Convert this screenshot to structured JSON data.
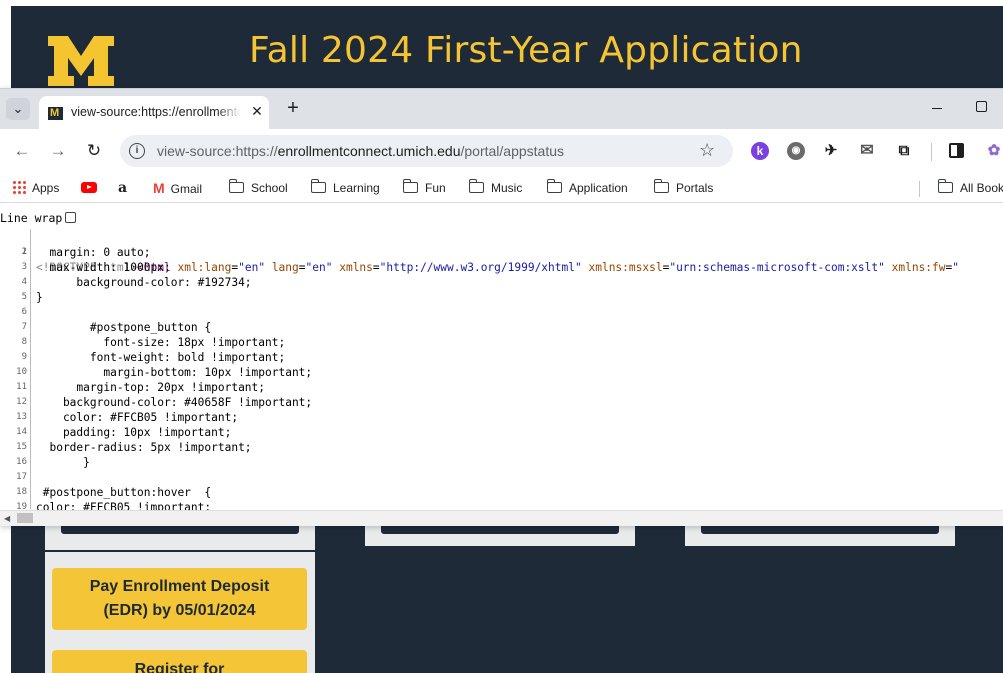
{
  "background_page": {
    "logo_letter": "M",
    "title": "Fall 2024 First-Year Application",
    "deposit_button": [
      "Pay Enrollment Deposit",
      "(EDR) by 05/01/2024"
    ],
    "register_button": "Register for",
    "colors": {
      "navy": "#1e2a38",
      "maize": "#f5c531",
      "panel": "#e9eaec",
      "button": "#f4c536"
    }
  },
  "browser": {
    "tab": {
      "title": "view-source:https://enrollmentconnect.umich.edu/portal/appstatus",
      "favicon": "umich-m-favicon",
      "close_glyph": "✕"
    },
    "tab_search_glyph": "⌄",
    "new_tab_glyph": "+",
    "nav": {
      "back": "←",
      "forward": "→",
      "reload": "↻"
    },
    "url": {
      "scheme": "view-source:https://",
      "host": "enrollmentconnect.umich.edu",
      "path": "/portal/appstatus"
    },
    "info_glyph": "i",
    "star_glyph": "☆",
    "extensions": [
      {
        "name": "k-extension-icon",
        "glyph": "k"
      },
      {
        "name": "tomato-extension-icon",
        "glyph": "◉"
      },
      {
        "name": "bird-extension-icon",
        "glyph": "✈"
      },
      {
        "name": "mail-extension-icon",
        "glyph": "✉"
      },
      {
        "name": "puzzle-extensions-icon",
        "glyph": "⧉"
      },
      {
        "name": "owl-extension-icon",
        "glyph": "✿"
      }
    ],
    "bookmarks": {
      "items": [
        {
          "label": "Apps",
          "icon": "apps-grid-icon"
        },
        {
          "label": "",
          "icon": "youtube-icon"
        },
        {
          "label": "a",
          "icon": "amazon-icon"
        },
        {
          "label": "Gmail",
          "icon": "gmail-icon"
        },
        {
          "label": "School",
          "icon": "folder-icon"
        },
        {
          "label": "Learning",
          "icon": "folder-icon"
        },
        {
          "label": "Fun",
          "icon": "folder-icon"
        },
        {
          "label": "Music",
          "icon": "folder-icon"
        },
        {
          "label": "Application",
          "icon": "folder-icon"
        },
        {
          "label": "Portals",
          "icon": "folder-icon"
        }
      ],
      "all_bookmarks": "All Bookmarks"
    },
    "gmail_glyph": "M"
  },
  "source_view": {
    "line_wrap_label": "Line wrap",
    "line_wrap_checked": false,
    "lines": [
      {
        "n": "1",
        "doctype": "<!DOCTYPE html>",
        "tag_open": "<html ",
        "attrs": [
          {
            "name": "xml:lang",
            "value": "\"en\""
          },
          {
            "name": "lang",
            "value": "\"en\""
          },
          {
            "name": "xmlns",
            "value": "\"http://www.w3.org/1999/xhtml\""
          },
          {
            "name": "xmlns:msxsl",
            "value": "\"urn:schemas-microsoft-com:xslt\""
          },
          {
            "name": "xmlns:fw",
            "value": "\""
          }
        ]
      },
      {
        "n": "2",
        "text": "  margin: 0 auto;"
      },
      {
        "n": "3",
        "text": "  max-width: 1000px;"
      },
      {
        "n": "4",
        "text": "      background-color: #192734;"
      },
      {
        "n": "5",
        "text": "}"
      },
      {
        "n": "6",
        "text": ""
      },
      {
        "n": "7",
        "text": "        #postpone_button {"
      },
      {
        "n": "8",
        "text": "          font-size: 18px !important;"
      },
      {
        "n": "9",
        "text": "        font-weight: bold !important;"
      },
      {
        "n": "10",
        "text": "          margin-bottom: 10px !important;"
      },
      {
        "n": "11",
        "text": "      margin-top: 20px !important;"
      },
      {
        "n": "12",
        "text": "    background-color: #40658F !important;"
      },
      {
        "n": "13",
        "text": "    color: #FFCB05 !important;"
      },
      {
        "n": "14",
        "text": "    padding: 10px !important;"
      },
      {
        "n": "15",
        "text": "  border-radius: 5px !important;"
      },
      {
        "n": "16",
        "text": "       }"
      },
      {
        "n": "17",
        "text": ""
      },
      {
        "n": "18",
        "text": " #postpone_button:hover  {"
      },
      {
        "n": "19",
        "text": "color: #FFCB05 !important;"
      }
    ]
  }
}
